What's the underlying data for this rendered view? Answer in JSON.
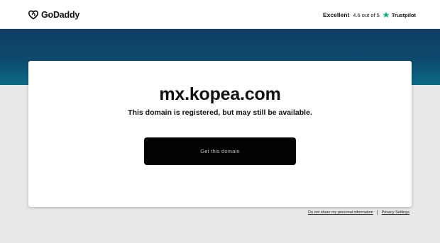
{
  "header": {
    "brand": "GoDaddy",
    "rating": {
      "label": "Excellent",
      "score": "4.6 out of 5",
      "provider": "Trustpilot"
    }
  },
  "card": {
    "domain": "mx.kopea.com",
    "message": "This domain is registered, but may still be available.",
    "cta_label": "Get this domain"
  },
  "footer": {
    "links": [
      "Do not share my personal information",
      "Privacy Settings"
    ],
    "separator": "|"
  },
  "colors": {
    "hero_top": "#0f3d63",
    "hero_bottom": "#0b6a86",
    "cta_background": "#020202",
    "trustpilot_star": "#00b67a",
    "page_background": "#e8e8e8"
  },
  "icons": {
    "brand": "godaddy-logo-icon",
    "rating": "trustpilot-star-icon"
  }
}
